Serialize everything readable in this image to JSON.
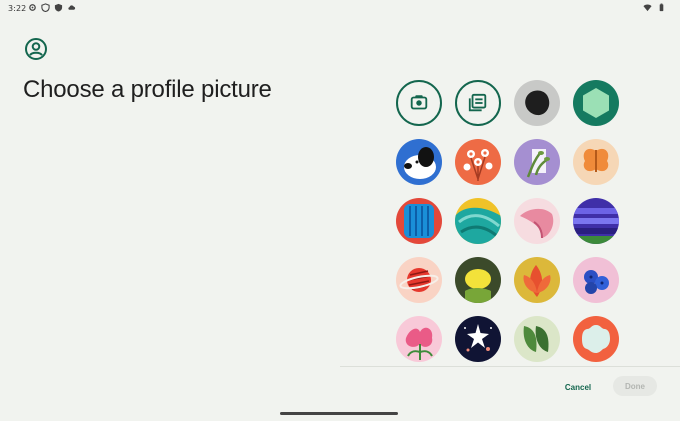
{
  "status_bar": {
    "time": "3:22"
  },
  "page": {
    "title": "Choose a profile picture"
  },
  "actions": {
    "cancel_label": "Cancel",
    "done_label": "Done"
  },
  "options": [
    {
      "name": "take-photo-option",
      "icon": "camera-icon"
    },
    {
      "name": "choose-image-option",
      "icon": "gallery-icon"
    },
    {
      "name": "avatar-dark-blob"
    },
    {
      "name": "avatar-green-hexagon"
    },
    {
      "name": "avatar-dog"
    },
    {
      "name": "avatar-orange-flowers"
    },
    {
      "name": "avatar-lavender-plant"
    },
    {
      "name": "avatar-butterfly"
    },
    {
      "name": "avatar-blue-stripes"
    },
    {
      "name": "avatar-teal-waves"
    },
    {
      "name": "avatar-pink-shape"
    },
    {
      "name": "avatar-purple-bands"
    },
    {
      "name": "avatar-red-planet"
    },
    {
      "name": "avatar-yellow-lemon"
    },
    {
      "name": "avatar-orange-leaves"
    },
    {
      "name": "avatar-blueberries"
    },
    {
      "name": "avatar-pink-flower"
    },
    {
      "name": "avatar-starry-night"
    },
    {
      "name": "avatar-green-petals"
    },
    {
      "name": "avatar-coral-flower"
    }
  ],
  "colors": {
    "accent": "#13664e",
    "background": "#f1f3ef"
  }
}
